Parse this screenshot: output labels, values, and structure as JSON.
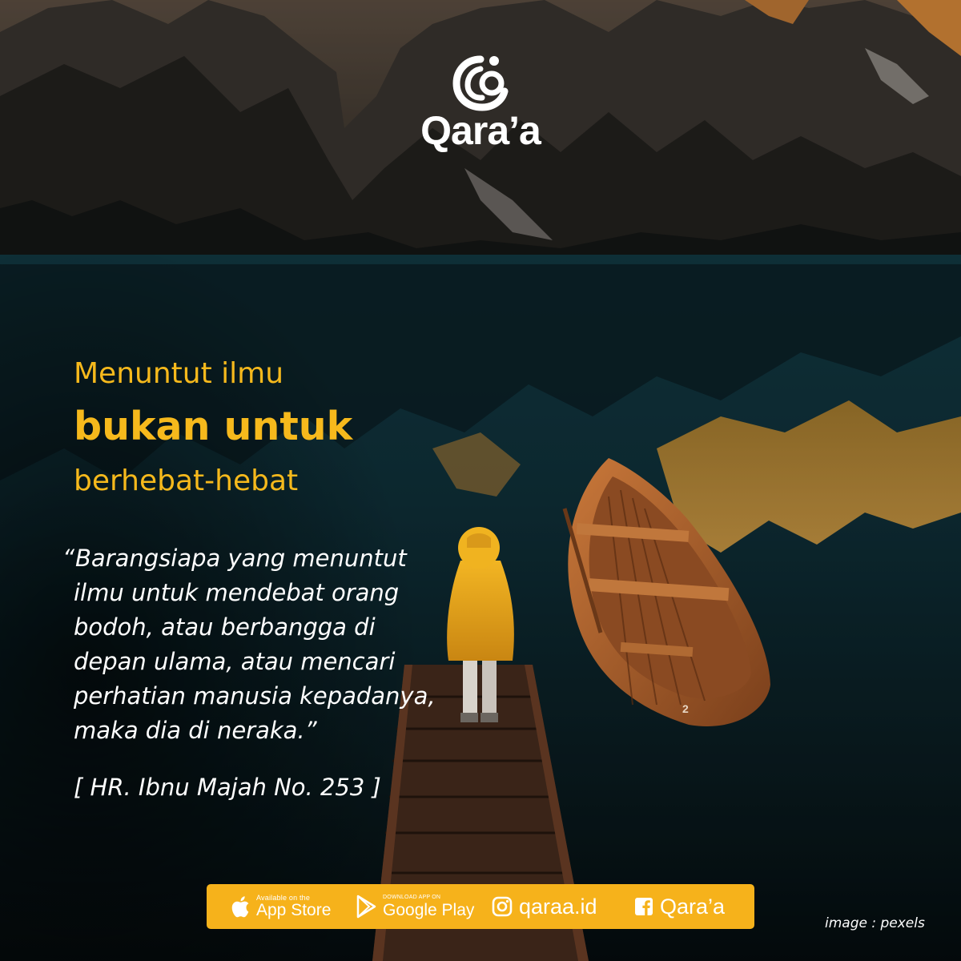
{
  "brand": {
    "name": "Qara’a",
    "icon": "qaraa-logo-icon"
  },
  "headline": {
    "line1": "Menuntut ilmu",
    "line2": "bukan untuk",
    "line3": "berhebat-hebat"
  },
  "quote": {
    "open_mark": "“",
    "lines": [
      "Barangsiapa yang menuntut",
      "ilmu untuk mendebat orang",
      "bodoh, atau berbangga di",
      "depan ulama, atau mencari",
      "perhatian manusia kepadanya,",
      "maka dia di neraka.”"
    ],
    "source": "[ HR. Ibnu Majah No. 253 ]"
  },
  "footer": {
    "app_store": {
      "small": "Available on the",
      "big": "App Store",
      "icon": "apple-icon"
    },
    "google_play": {
      "small": "DOWNLOAD APP ON",
      "big": "Google Play",
      "icon": "google-play-icon"
    },
    "instagram": {
      "label": "qaraa.id",
      "icon": "instagram-icon"
    },
    "facebook": {
      "label": "Qara’a",
      "icon": "facebook-icon"
    }
  },
  "credit": "image : pexels",
  "colors": {
    "accent": "#f6b21b",
    "headline": "#f6b91c",
    "text": "#ffffff",
    "water": "#0f3540",
    "mountain": "#2a2a2a"
  }
}
